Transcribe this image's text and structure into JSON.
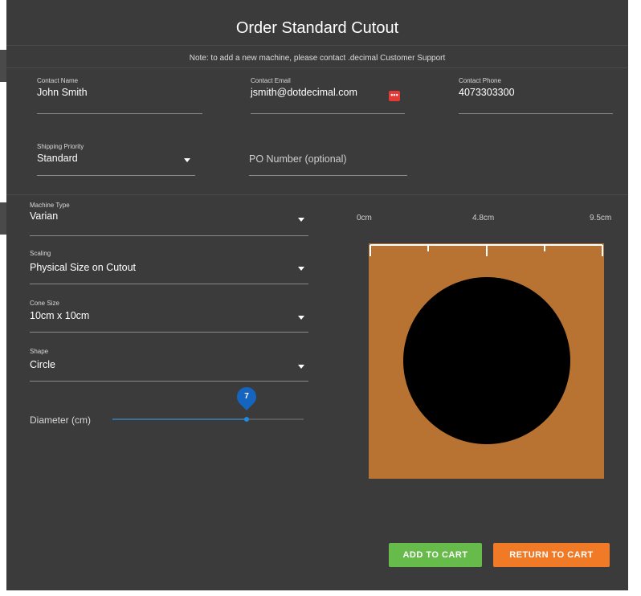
{
  "dialog": {
    "title": "Order Standard Cutout",
    "note": "Note: to add a new machine, please contact .decimal Customer Support"
  },
  "contact": {
    "name_label": "Contact Name",
    "name_value": "John Smith",
    "email_label": "Contact Email",
    "email_value": "jsmith@dotdecimal.com",
    "email_icon": "autofill-icon",
    "phone_label": "Contact Phone",
    "phone_value": "4073303300"
  },
  "shipping": {
    "priority_label": "Shipping Priority",
    "priority_value": "Standard",
    "po_placeholder": "PO Number (optional)"
  },
  "machine": {
    "type_label": "Machine Type",
    "type_value": "Varian",
    "scaling_label": "Scaling",
    "scaling_value": "Physical Size on Cutout",
    "cone_label": "Cone Size",
    "cone_value": "10cm x 10cm",
    "shape_label": "Shape",
    "shape_value": "Circle"
  },
  "diameter": {
    "label": "Diameter (cm)",
    "value": "7",
    "fraction": 0.7
  },
  "preview": {
    "ruler_labels": [
      "0cm",
      "4.8cm",
      "9.5cm"
    ],
    "cutout_color": "#b87333",
    "shape_color": "#000000"
  },
  "actions": {
    "add_to_cart": "ADD TO CART",
    "return_to_cart": "RETURN TO CART",
    "add_color": "#66bb4a",
    "return_color": "#f07a26"
  }
}
